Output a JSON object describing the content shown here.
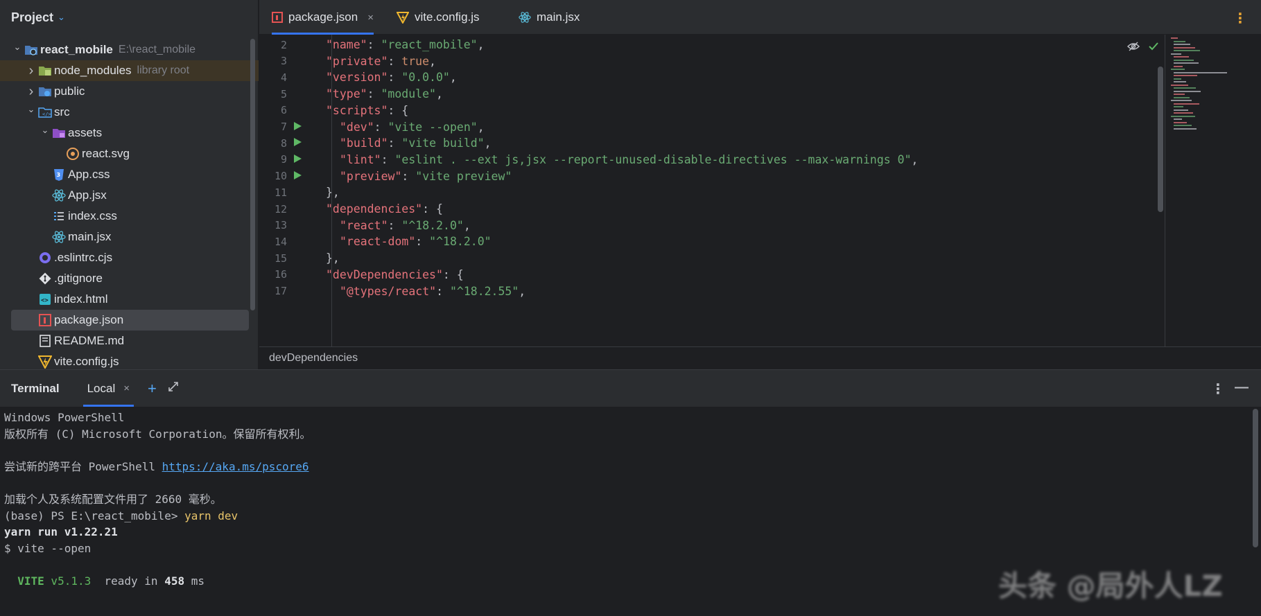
{
  "project": {
    "title": "Project",
    "tree": [
      {
        "label": "react_mobile",
        "hint": "E:\\react_mobile",
        "icon": "module-folder-icon",
        "depth": 0,
        "arrow": "v"
      },
      {
        "label": "node_modules",
        "hint": "library root",
        "icon": "library-folder-icon",
        "depth": 1,
        "arrow": ">"
      },
      {
        "label": "public",
        "hint": "",
        "icon": "web-folder-icon",
        "depth": 1,
        "arrow": ">"
      },
      {
        "label": "src",
        "hint": "",
        "icon": "source-folder-icon",
        "depth": 1,
        "arrow": "v"
      },
      {
        "label": "assets",
        "hint": "",
        "icon": "resource-folder-icon",
        "depth": 2,
        "arrow": "v"
      },
      {
        "label": "react.svg",
        "hint": "",
        "icon": "svg-file-icon",
        "depth": 3,
        "arrow": ""
      },
      {
        "label": "App.css",
        "hint": "",
        "icon": "css-file-icon",
        "depth": 2,
        "arrow": ""
      },
      {
        "label": "App.jsx",
        "hint": "",
        "icon": "react-file-icon",
        "depth": 2,
        "arrow": ""
      },
      {
        "label": "index.css",
        "hint": "",
        "icon": "stylesheet-file-icon",
        "depth": 2,
        "arrow": ""
      },
      {
        "label": "main.jsx",
        "hint": "",
        "icon": "react-file-icon",
        "depth": 2,
        "arrow": ""
      },
      {
        "label": ".eslintrc.cjs",
        "hint": "",
        "icon": "eslint-file-icon",
        "depth": 1,
        "arrow": ""
      },
      {
        "label": ".gitignore",
        "hint": "",
        "icon": "git-file-icon",
        "depth": 1,
        "arrow": ""
      },
      {
        "label": "index.html",
        "hint": "",
        "icon": "html-file-icon",
        "depth": 1,
        "arrow": ""
      },
      {
        "label": "package.json",
        "hint": "",
        "icon": "npm-file-icon",
        "depth": 1,
        "arrow": ""
      },
      {
        "label": "README.md",
        "hint": "",
        "icon": "markdown-file-icon",
        "depth": 1,
        "arrow": ""
      },
      {
        "label": "vite.config.js",
        "hint": "",
        "icon": "vite-file-icon",
        "depth": 1,
        "arrow": ""
      }
    ]
  },
  "editor": {
    "tabs": [
      {
        "label": "package.json",
        "icon": "npm-file-icon",
        "close": "×"
      },
      {
        "label": "vite.config.js",
        "icon": "vite-file-icon",
        "close": ""
      },
      {
        "label": "main.jsx",
        "icon": "react-file-icon",
        "close": ""
      }
    ],
    "menu": "⋮",
    "lines": [
      {
        "n": "2",
        "run": false,
        "indent": 1,
        "tokens": [
          [
            "key",
            "\"name\""
          ],
          [
            "punc",
            ": "
          ],
          [
            "str",
            "\"react_mobile\""
          ],
          [
            "punc",
            ","
          ]
        ]
      },
      {
        "n": "3",
        "run": false,
        "indent": 1,
        "tokens": [
          [
            "key",
            "\"private\""
          ],
          [
            "punc",
            ": "
          ],
          [
            "kw",
            "true"
          ],
          [
            "punc",
            ","
          ]
        ]
      },
      {
        "n": "4",
        "run": false,
        "indent": 1,
        "tokens": [
          [
            "key",
            "\"version\""
          ],
          [
            "punc",
            ": "
          ],
          [
            "str",
            "\"0.0.0\""
          ],
          [
            "punc",
            ","
          ]
        ]
      },
      {
        "n": "5",
        "run": false,
        "indent": 1,
        "tokens": [
          [
            "key",
            "\"type\""
          ],
          [
            "punc",
            ": "
          ],
          [
            "str",
            "\"module\""
          ],
          [
            "punc",
            ","
          ]
        ]
      },
      {
        "n": "6",
        "run": false,
        "indent": 1,
        "tokens": [
          [
            "key",
            "\"scripts\""
          ],
          [
            "punc",
            ": {"
          ]
        ]
      },
      {
        "n": "7",
        "run": true,
        "indent": 2,
        "tokens": [
          [
            "key",
            "\"dev\""
          ],
          [
            "punc",
            ": "
          ],
          [
            "str",
            "\"vite --open\""
          ],
          [
            "punc",
            ","
          ]
        ]
      },
      {
        "n": "8",
        "run": true,
        "indent": 2,
        "tokens": [
          [
            "key",
            "\"build\""
          ],
          [
            "punc",
            ": "
          ],
          [
            "str",
            "\"vite build\""
          ],
          [
            "punc",
            ","
          ]
        ]
      },
      {
        "n": "9",
        "run": true,
        "indent": 2,
        "tokens": [
          [
            "key",
            "\"lint\""
          ],
          [
            "punc",
            ": "
          ],
          [
            "str",
            "\"eslint . --ext js,jsx --report-unused-disable-directives --max-warnings 0\""
          ],
          [
            "punc",
            ","
          ]
        ]
      },
      {
        "n": "10",
        "run": true,
        "indent": 2,
        "tokens": [
          [
            "key",
            "\"preview\""
          ],
          [
            "punc",
            ": "
          ],
          [
            "str",
            "\"vite preview\""
          ]
        ]
      },
      {
        "n": "11",
        "run": false,
        "indent": 1,
        "tokens": [
          [
            "punc",
            "},"
          ]
        ]
      },
      {
        "n": "12",
        "run": false,
        "indent": 1,
        "tokens": [
          [
            "key",
            "\"dependencies\""
          ],
          [
            "punc",
            ": {"
          ]
        ]
      },
      {
        "n": "13",
        "run": false,
        "indent": 2,
        "tokens": [
          [
            "key",
            "\"react\""
          ],
          [
            "punc",
            ": "
          ],
          [
            "str",
            "\"^18.2.0\""
          ],
          [
            "punc",
            ","
          ]
        ]
      },
      {
        "n": "14",
        "run": false,
        "indent": 2,
        "tokens": [
          [
            "key",
            "\"react-dom\""
          ],
          [
            "punc",
            ": "
          ],
          [
            "str",
            "\"^18.2.0\""
          ]
        ]
      },
      {
        "n": "15",
        "run": false,
        "indent": 1,
        "tokens": [
          [
            "punc",
            "},"
          ]
        ]
      },
      {
        "n": "16",
        "run": false,
        "indent": 1,
        "tokens": [
          [
            "key",
            "\"devDependencies\""
          ],
          [
            "punc",
            ": {"
          ]
        ]
      },
      {
        "n": "17",
        "run": false,
        "indent": 2,
        "tokens": [
          [
            "key",
            "\"@types/react\""
          ],
          [
            "punc",
            ": "
          ],
          [
            "str",
            "\"^18.2.55\""
          ],
          [
            "punc",
            ","
          ]
        ]
      }
    ],
    "breadcrumb": "devDependencies"
  },
  "terminal": {
    "title": "Terminal",
    "tab_label": "Local",
    "tab_close": "×",
    "add": "+",
    "menu": "⋮",
    "minimize": "—",
    "lines": [
      [
        [
          "plain",
          "Windows PowerShell"
        ]
      ],
      [
        [
          "plain",
          "版权所有 (C) Microsoft Corporation。保留所有权利。"
        ]
      ],
      [
        [
          "plain",
          ""
        ]
      ],
      [
        [
          "plain",
          "尝试新的跨平台 PowerShell "
        ],
        [
          "link",
          "https://aka.ms/pscore6"
        ]
      ],
      [
        [
          "plain",
          ""
        ]
      ],
      [
        [
          "plain",
          "加载个人及系统配置文件用了 2660 毫秒。"
        ]
      ],
      [
        [
          "plain",
          "(base) PS E:\\react_mobile> "
        ],
        [
          "cmd",
          "yarn dev"
        ]
      ],
      [
        [
          "bold",
          "yarn run v1.22.21"
        ]
      ],
      [
        [
          "plain",
          "$ vite --open"
        ]
      ],
      [
        [
          "plain",
          ""
        ]
      ],
      [
        [
          "plain",
          "  "
        ],
        [
          "vite",
          "VITE"
        ],
        [
          "ver",
          " v5.1.3"
        ],
        [
          "plain",
          "  ready in "
        ],
        [
          "bold",
          "458"
        ],
        [
          "plain",
          " ms"
        ]
      ]
    ]
  },
  "watermark": "头条 @局外人LZ",
  "colors": {
    "background": "#1e1f22",
    "panel": "#2b2d30",
    "accent": "#3574f0",
    "json_key": "#e5737b",
    "json_string": "#6aab73",
    "json_keyword": "#cf8e6d",
    "run_gutter": "#5fb865"
  }
}
